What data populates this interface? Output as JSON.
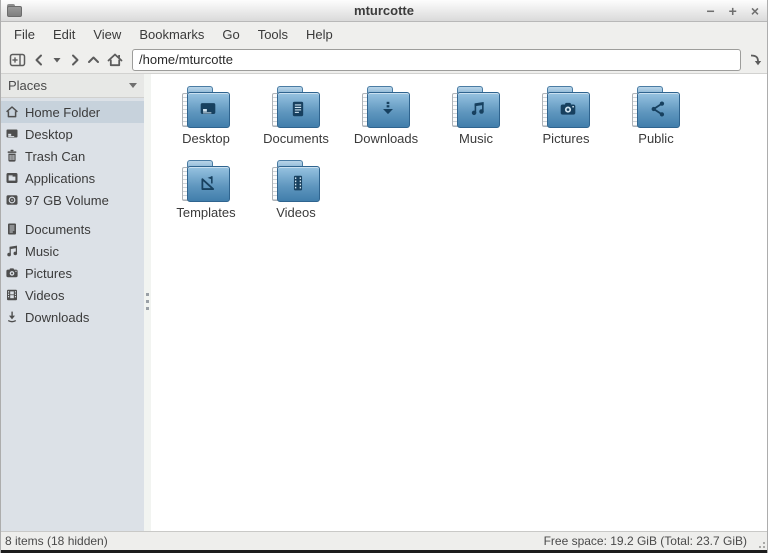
{
  "window": {
    "title": "mturcotte",
    "minimize": "−",
    "maximize": "+",
    "close": "×"
  },
  "menu": {
    "items": [
      "File",
      "Edit",
      "View",
      "Bookmarks",
      "Go",
      "Tools",
      "Help"
    ]
  },
  "toolbar": {
    "path_value": "/home/mturcotte",
    "buttons": [
      "new-tab",
      "back",
      "history-dropdown",
      "forward",
      "up",
      "home",
      "go-jump"
    ]
  },
  "sidebar": {
    "header": "Places",
    "items": [
      {
        "label": "Home Folder",
        "icon": "home-icon",
        "selected": true
      },
      {
        "label": "Desktop",
        "icon": "desktop-icon",
        "selected": false
      },
      {
        "label": "Trash Can",
        "icon": "trash-icon",
        "selected": false
      },
      {
        "label": "Applications",
        "icon": "applications-icon",
        "selected": false
      },
      {
        "label": "97 GB Volume",
        "icon": "volume-icon",
        "selected": false
      },
      {
        "label": "Documents",
        "icon": "documents-icon",
        "selected": false
      },
      {
        "label": "Music",
        "icon": "music-icon",
        "selected": false
      },
      {
        "label": "Pictures",
        "icon": "pictures-icon",
        "selected": false
      },
      {
        "label": "Videos",
        "icon": "videos-icon",
        "selected": false
      },
      {
        "label": "Downloads",
        "icon": "downloads-icon",
        "selected": false
      }
    ]
  },
  "files": {
    "items": [
      {
        "label": "Desktop",
        "icon": "desktop-folder-icon"
      },
      {
        "label": "Documents",
        "icon": "documents-folder-icon"
      },
      {
        "label": "Downloads",
        "icon": "downloads-folder-icon"
      },
      {
        "label": "Music",
        "icon": "music-folder-icon"
      },
      {
        "label": "Pictures",
        "icon": "pictures-folder-icon"
      },
      {
        "label": "Public",
        "icon": "public-folder-icon"
      },
      {
        "label": "Templates",
        "icon": "templates-folder-icon"
      },
      {
        "label": "Videos",
        "icon": "videos-folder-icon"
      }
    ]
  },
  "status": {
    "left": "8 items (18 hidden)",
    "right": "Free space: 19.2 GiB (Total: 23.7 GiB)"
  },
  "colors": {
    "folder_top": "#97c3e1",
    "folder_bottom": "#417eab",
    "folder_border": "#2f648f",
    "emblem": "#17405f",
    "emblem_light": "#cfe3f0",
    "sidebar_bg": "#dce1e7",
    "sidebar_selected": "#c7d2dc",
    "chrome_bg": "#efefed",
    "status_bg": "#eeeeec"
  }
}
